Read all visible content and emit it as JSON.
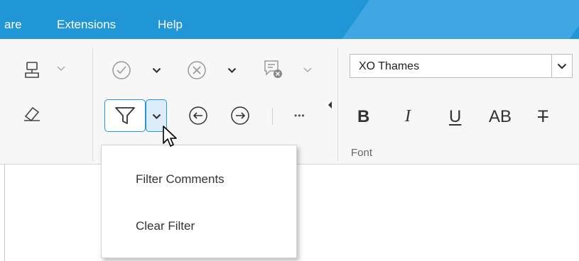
{
  "menubar": {
    "items": [
      "are",
      "Extensions",
      "Help"
    ]
  },
  "font": {
    "name": "XO Thames",
    "group_label": "Font"
  },
  "format_buttons": {
    "bold": "B",
    "italic": "I",
    "underline": "U",
    "caps": "AB",
    "strikethrough": "T"
  },
  "toolbar": {
    "more": "•••"
  },
  "dropdown": {
    "items": [
      "Filter Comments",
      "Clear Filter"
    ]
  },
  "colors": {
    "menubar": "#2196d6",
    "accent": "#2196d6"
  }
}
